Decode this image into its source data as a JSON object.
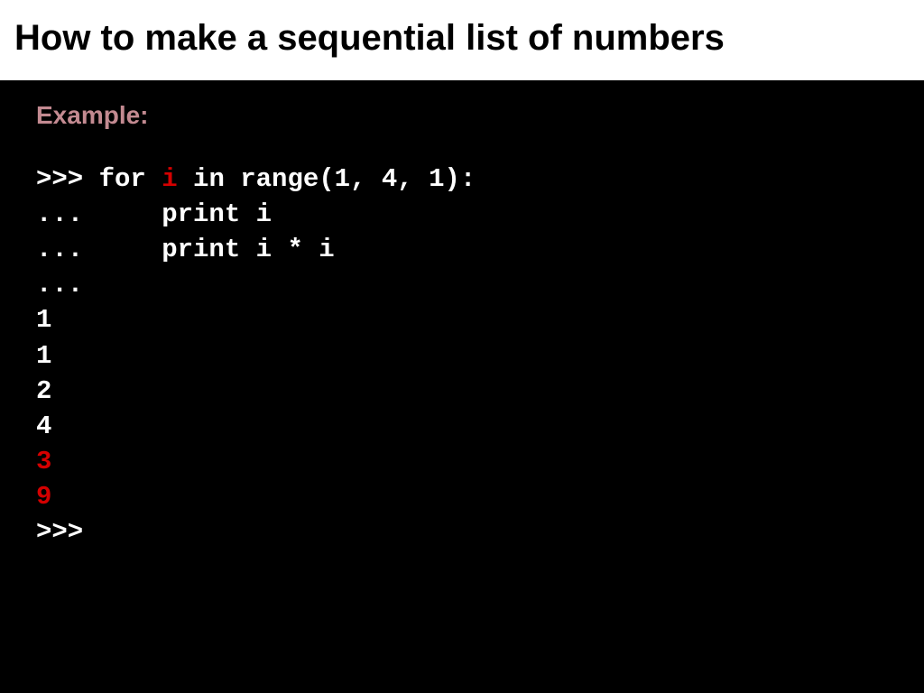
{
  "header": {
    "title": "How to make a sequential list of numbers"
  },
  "example_label": "Example:",
  "code": {
    "line1_pre": ">>> for ",
    "line1_var": "i",
    "line1_post": " in range(1, 4, 1):",
    "line2": "...     print i",
    "line3": "...     print i * i",
    "line4": "...",
    "out1": "1",
    "out2": "1",
    "out3": "2",
    "out4": "4",
    "out5": "3",
    "out6": "9",
    "prompt_end": ">>>"
  }
}
